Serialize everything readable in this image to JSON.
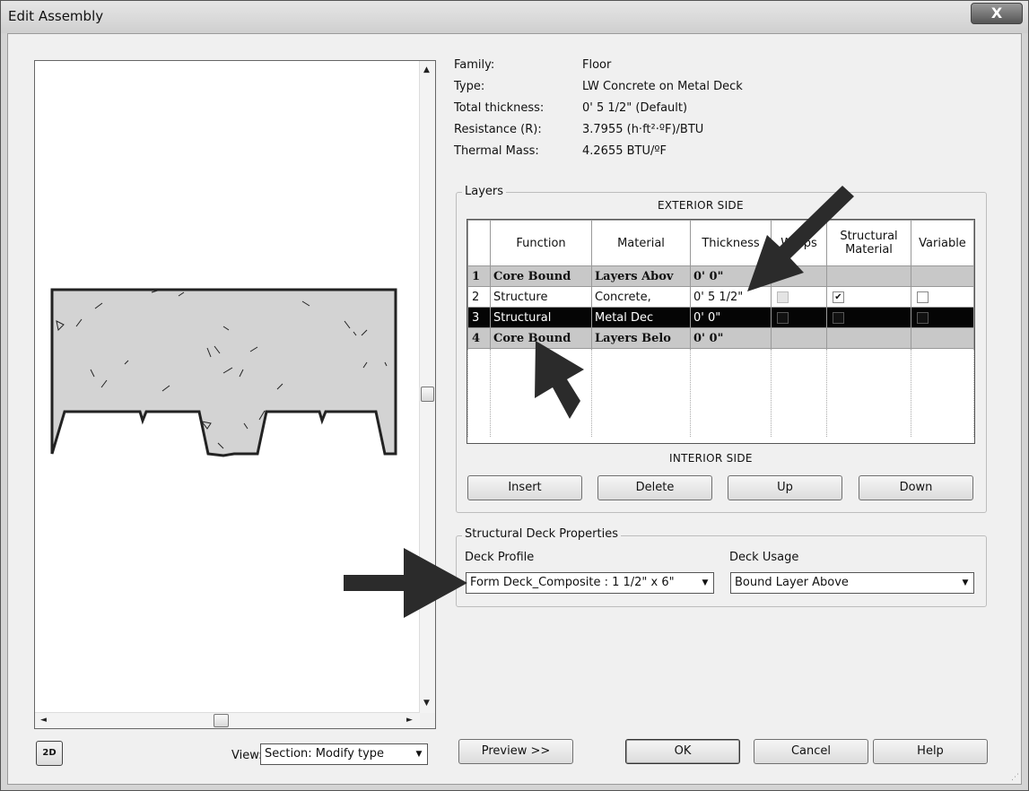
{
  "window": {
    "title": "Edit Assembly",
    "close_glyph": "X"
  },
  "info": [
    {
      "label": "Family:",
      "value": "Floor"
    },
    {
      "label": "Type:",
      "value": "LW Concrete on Metal Deck"
    },
    {
      "label": "Total thickness:",
      "value": "0'  5 1/2\" (Default)"
    },
    {
      "label": "Resistance (R):",
      "value": "3.7955 (h·ft²·ºF)/BTU"
    },
    {
      "label": "Thermal Mass:",
      "value": "4.2655 BTU/ºF"
    }
  ],
  "layers": {
    "group_label": "Layers",
    "exterior_label": "EXTERIOR SIDE",
    "interior_label": "INTERIOR SIDE",
    "columns": [
      "",
      "Function",
      "Material",
      "Thickness",
      "Wraps",
      "Structural Material",
      "Variable"
    ],
    "rows": [
      {
        "num": "1",
        "function": "Core Bound",
        "material": "Layers Abov",
        "thickness": "0'  0\"",
        "style": "gray"
      },
      {
        "num": "2",
        "function": "Structure",
        "material": "Concrete,",
        "thickness": "0'  5 1/2\"",
        "style": "normal",
        "wraps": false,
        "structural": true,
        "variable": false
      },
      {
        "num": "3",
        "function": "Structural",
        "material": "Metal Dec",
        "thickness": "0'  0\"",
        "style": "selected"
      },
      {
        "num": "4",
        "function": "Core Bound",
        "material": "Layers Belo",
        "thickness": "0'  0\"",
        "style": "gray"
      }
    ],
    "buttons": {
      "insert": "Insert",
      "delete": "Delete",
      "up": "Up",
      "down": "Down"
    }
  },
  "deck": {
    "group_label": "Structural Deck Properties",
    "profile_label": "Deck Profile",
    "profile_value": "Form Deck_Composite : 1 1/2\" x 6\"",
    "usage_label": "Deck Usage",
    "usage_value": "Bound Layer Above"
  },
  "footer": {
    "view_label": "View:",
    "view_value": "Section: Modify type",
    "preview_button": "Preview >>",
    "ok": "OK",
    "cancel": "Cancel",
    "help": "Help",
    "icon_2d_text": "2D"
  }
}
